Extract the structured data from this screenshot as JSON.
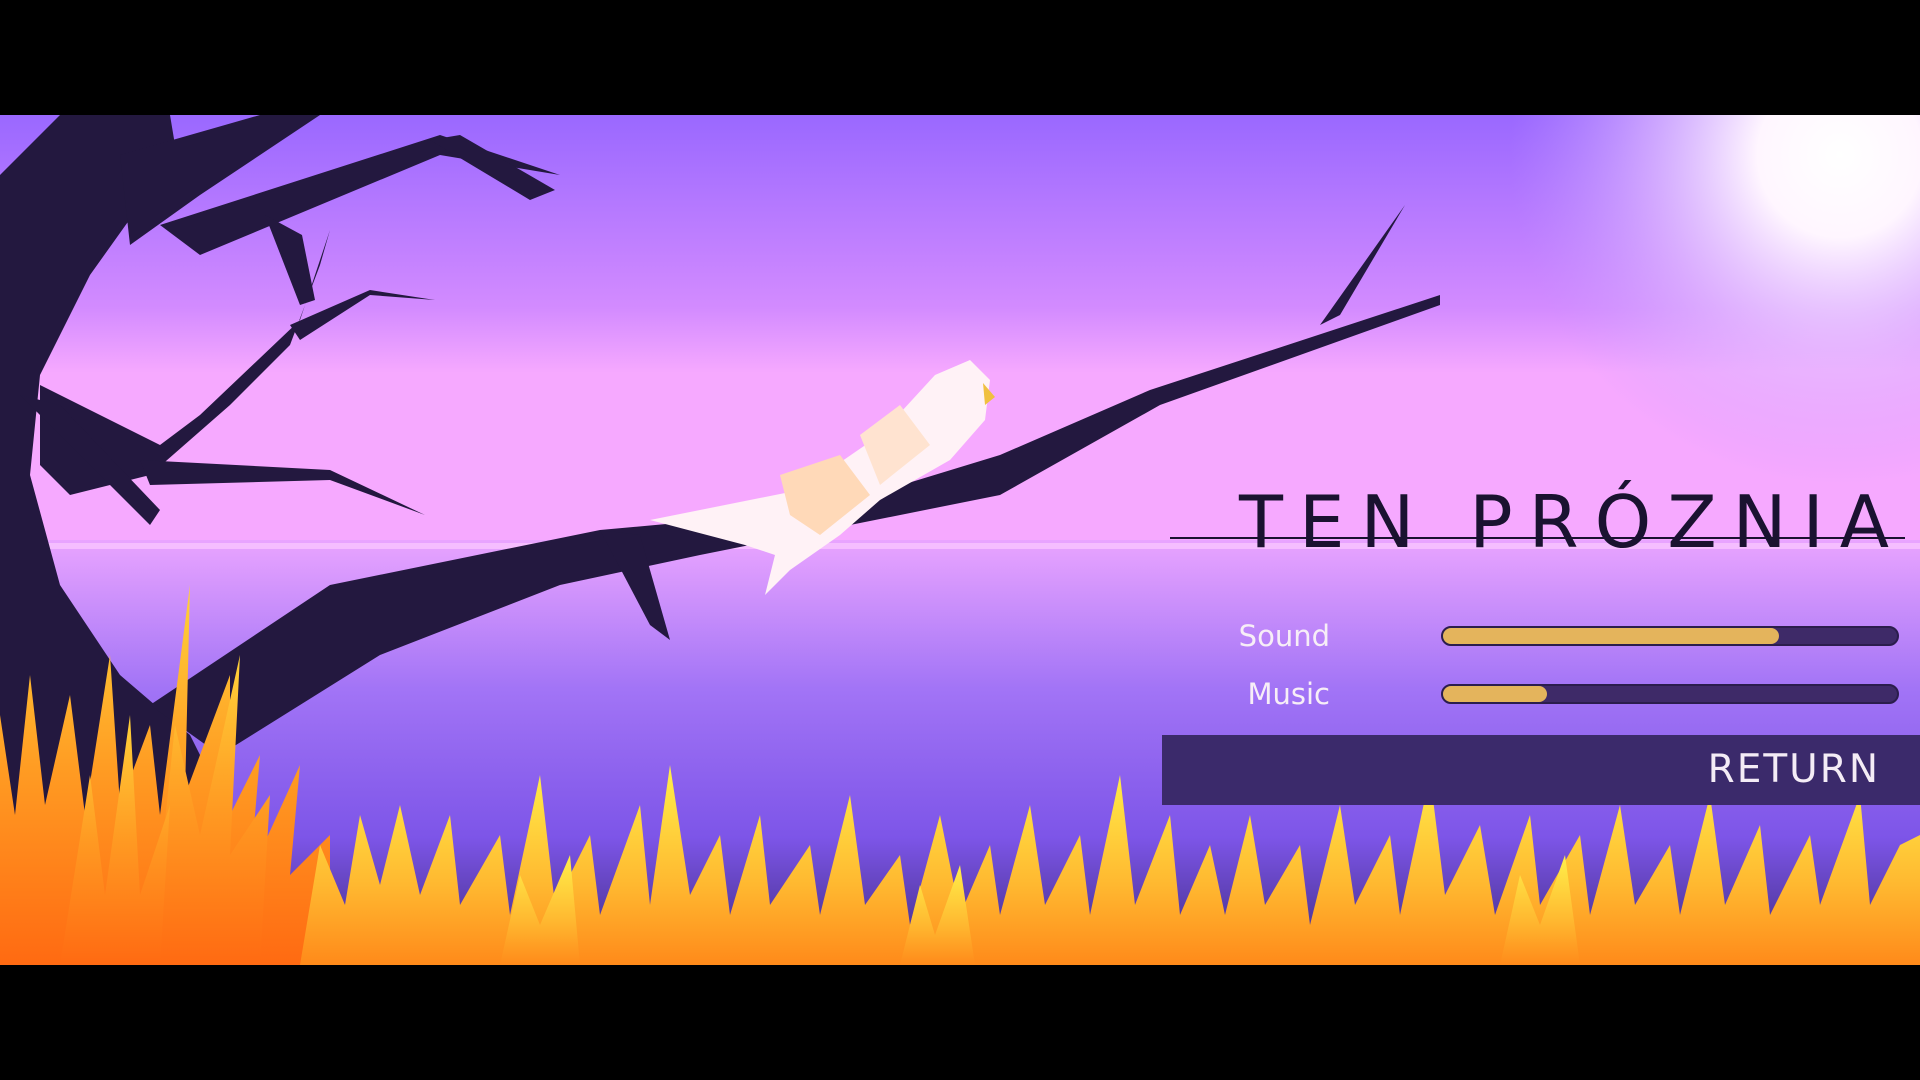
{
  "game": {
    "title": "TEN PRÓZNIA"
  },
  "settings": {
    "sound": {
      "label": "Sound",
      "value": 0.74
    },
    "music": {
      "label": "Music",
      "value": 0.23
    }
  },
  "menu": {
    "return_label": "RETURN"
  },
  "colors": {
    "sky_top": "#9a68ff",
    "sky_horizon": "#f6a9ff",
    "water": "#8a62f0",
    "tree": "#23183f",
    "grass": "#f09a2a",
    "slider_fill": "#e4b45c",
    "slider_track": "#3e2a68",
    "button_bg": "#3b2a6b"
  }
}
